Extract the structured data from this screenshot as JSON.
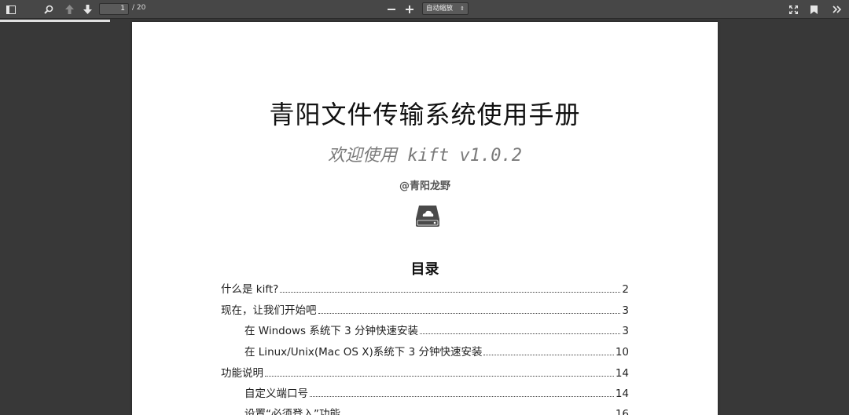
{
  "toolbar": {
    "current_page": "1",
    "page_total": "/ 20",
    "zoom": "自动缩放"
  },
  "document": {
    "title": "青阳文件传输系统使用手册",
    "subtitle": "欢迎使用 kift v1.0.2",
    "author": "@青阳龙野",
    "icon": "cloud-drive-icon",
    "toc_heading": "目录",
    "toc": [
      {
        "text": "什么是 kift?",
        "page": "2",
        "level": 1
      },
      {
        "text": "现在，让我们开始吧",
        "page": "3",
        "level": 1
      },
      {
        "text": "在 Windows 系统下 3 分钟快速安装",
        "page": "3",
        "level": 2
      },
      {
        "text": "在 Linux/Unix(Mac OS X)系统下 3 分钟快速安装",
        "page": "10",
        "level": 2
      },
      {
        "text": "功能说明",
        "page": "14",
        "level": 1
      },
      {
        "text": "自定义端口号",
        "page": "14",
        "level": 2
      },
      {
        "text": "设置“必须登入”功能",
        "page": "16",
        "level": 2
      }
    ]
  },
  "colors": {
    "toolbar_bg": "#474747",
    "viewer_bg": "#383838",
    "page_bg": "#ffffff"
  }
}
